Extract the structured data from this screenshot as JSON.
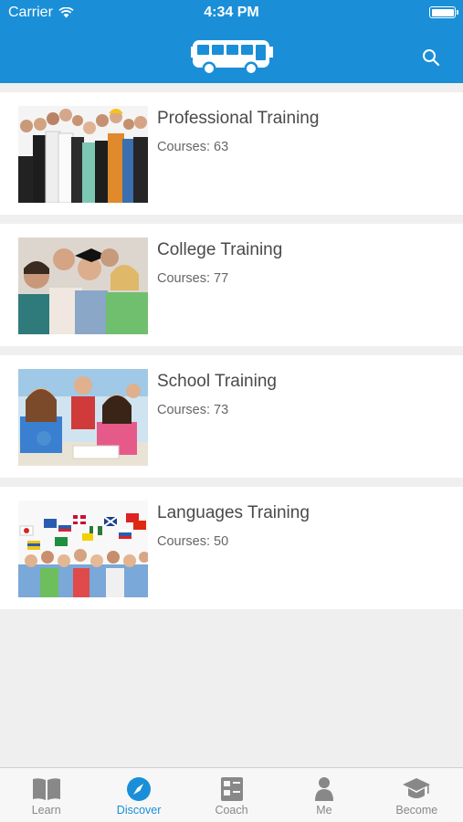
{
  "status_bar": {
    "carrier": "Carrier",
    "time": "4:34 PM"
  },
  "header": {
    "logo_icon": "bus-icon",
    "search_icon": "search-icon"
  },
  "categories": [
    {
      "title": "Professional Training",
      "courses": "Courses: 63"
    },
    {
      "title": "College Training",
      "courses": "Courses: 77"
    },
    {
      "title": "School Training",
      "courses": "Courses: 73"
    },
    {
      "title": "Languages Training",
      "courses": "Courses: 50"
    }
  ],
  "tabbar": {
    "tabs": [
      {
        "label": "Learn",
        "icon": "book-icon"
      },
      {
        "label": "Discover",
        "icon": "compass-icon",
        "active": true
      },
      {
        "label": "Coach",
        "icon": "checklist-icon"
      },
      {
        "label": "Me",
        "icon": "person-icon"
      },
      {
        "label": "Become",
        "icon": "graduation-cap-icon"
      }
    ]
  },
  "colors": {
    "accent": "#1a8fd8",
    "background": "#efefef",
    "inactive": "#888888"
  }
}
